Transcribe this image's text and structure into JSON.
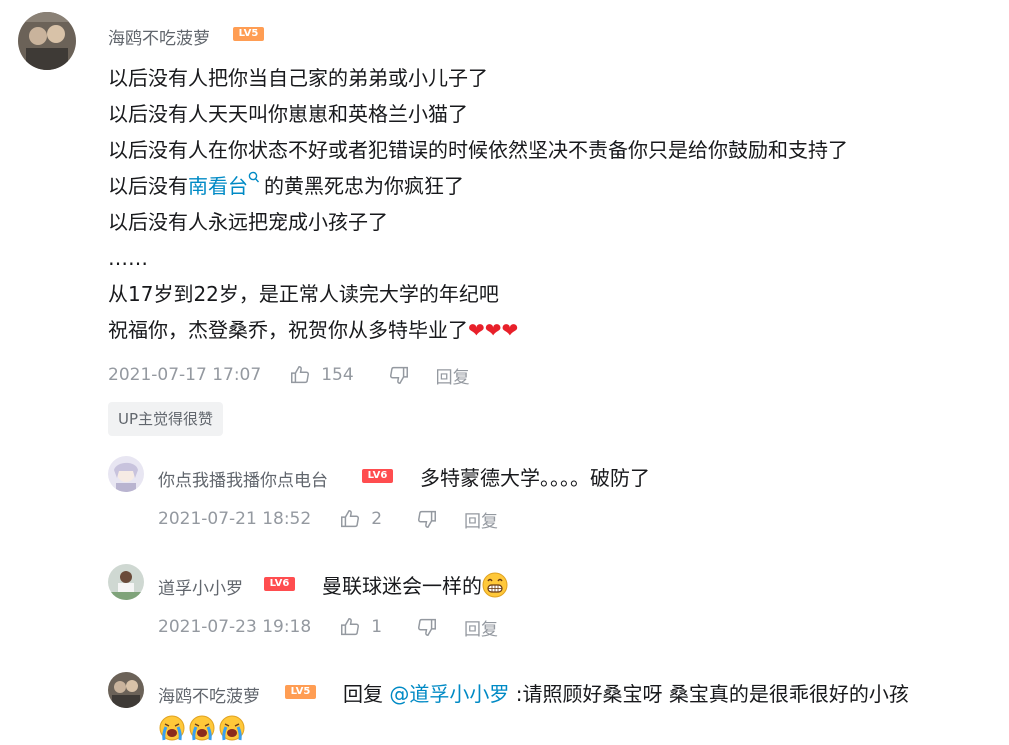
{
  "main_comment": {
    "username": "海鸥不吃菠萝",
    "level": "LV5",
    "lines": [
      "以后没有人把你当自己家的弟弟或小儿子了",
      "以后没有人天天叫你崽崽和英格兰小猫了",
      "以后没有人在你状态不好或者犯错误的时候依然坚决不责备你只是给你鼓励和支持了"
    ],
    "line4_prefix": "以后没有",
    "line4_link": "南看台",
    "line4_suffix": "的黄黑死忠为你疯狂了",
    "line5": "以后没有人永远把宠成小孩子了",
    "line6": "……",
    "line7": "从17岁到22岁，是正常人读完大学的年纪吧",
    "line8": "祝福你，杰登桑乔，祝贺你从多特毕业了",
    "hearts": "❤❤❤",
    "time": "2021-07-17 17:07",
    "likes": "154",
    "reply_label": "回复",
    "up_badge": "UP主觉得很赞"
  },
  "replies": [
    {
      "username": "你点我播我播你点电台",
      "level": "LV6",
      "text": "多特蒙德大学。。。。破防了",
      "time": "2021-07-21 18:52",
      "likes": "2",
      "reply_label": "回复"
    },
    {
      "username": "道孚小小罗",
      "level": "LV6",
      "text": "曼联球迷会一样的",
      "time": "2021-07-23 19:18",
      "likes": "1",
      "reply_label": "回复"
    },
    {
      "username": "海鸥不吃菠萝",
      "level": "LV5",
      "reply_prefix": "回复",
      "mention": "@道孚小小罗",
      "text": ":请照顾好桑宝呀 桑宝真的是很乖很好的小孩"
    }
  ],
  "icons": {
    "like": "thumbs-up-icon",
    "dislike": "thumbs-down-icon",
    "search": "search-icon",
    "heart": "heart-emoji",
    "grin": "grin-emoji",
    "cry": "crying-emoji"
  },
  "colors": {
    "link": "#008ac5",
    "meta": "#9499a0",
    "lv5": "#ff9d53",
    "lv6": "#ff4d4f"
  }
}
